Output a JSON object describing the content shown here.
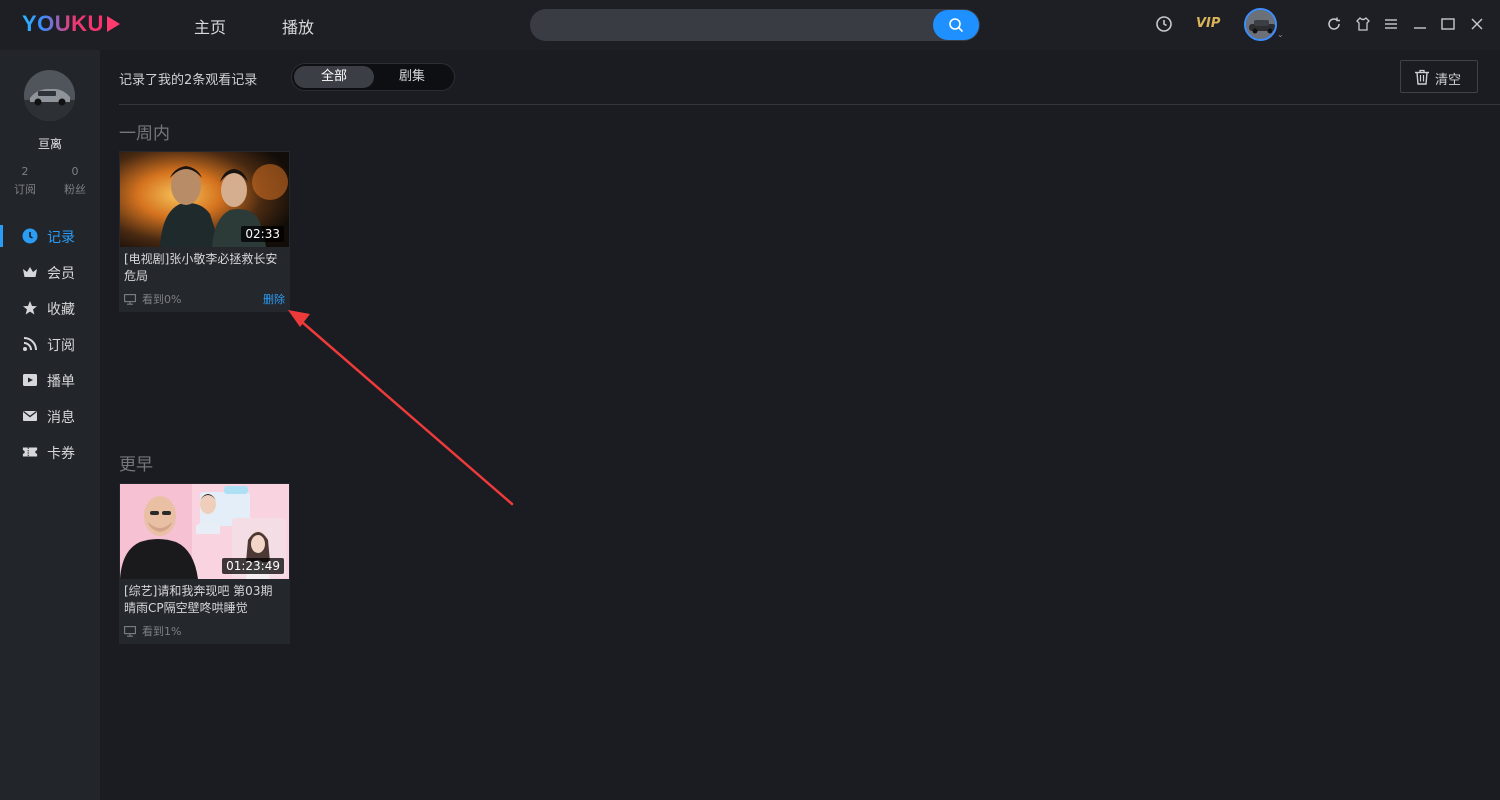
{
  "app": {
    "logo_text": "YOUKU",
    "brand_colors": {
      "accent": "#1e90ff",
      "logo_pink": "#ff3a6e",
      "vip_gold": "#d9b45a"
    }
  },
  "topbar": {
    "nav": [
      {
        "label": "主页"
      },
      {
        "label": "播放"
      }
    ],
    "search": {
      "value": "",
      "placeholder": ""
    },
    "vip_label": "VIP",
    "icons": [
      "history-icon",
      "refresh-icon",
      "skin-icon",
      "menu-icon",
      "minimize-icon",
      "maximize-icon",
      "close-icon"
    ]
  },
  "sidebar": {
    "username": "亘离",
    "stats": [
      {
        "count": "2",
        "label": "订阅"
      },
      {
        "count": "0",
        "label": "粉丝"
      }
    ],
    "items": [
      {
        "label": "记录",
        "icon": "clock-icon",
        "active": true
      },
      {
        "label": "会员",
        "icon": "crown-icon"
      },
      {
        "label": "收藏",
        "icon": "star-icon"
      },
      {
        "label": "订阅",
        "icon": "rss-icon"
      },
      {
        "label": "播单",
        "icon": "playlist-icon"
      },
      {
        "label": "消息",
        "icon": "mail-icon"
      },
      {
        "label": "卡券",
        "icon": "ticket-icon"
      }
    ]
  },
  "main": {
    "record_count": "记录了我的2条观看记录",
    "filter": {
      "all": "全部",
      "series": "剧集",
      "selected": "全部"
    },
    "clear_label": "清空",
    "sections": [
      {
        "title": "一周内",
        "items": [
          {
            "title": "[电视剧]张小敬李必拯救长安危局",
            "duration": "02:33",
            "progress": "看到0%",
            "delete_label": "删除"
          }
        ]
      },
      {
        "title": "更早",
        "items": [
          {
            "title": "[综艺]请和我奔现吧 第03期 晴雨CP隔空壁咚哄睡觉",
            "duration": "01:23:49",
            "progress": "看到1%"
          }
        ]
      }
    ]
  }
}
